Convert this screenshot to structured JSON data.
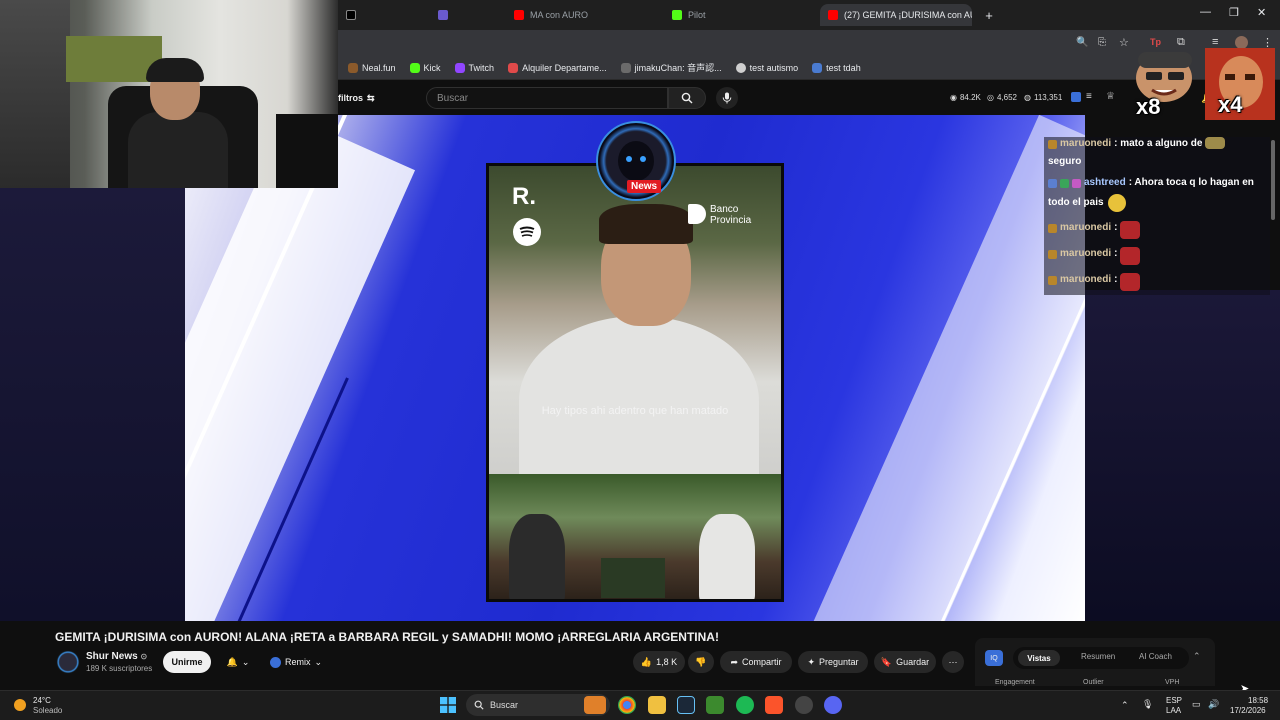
{
  "browser": {
    "tabs": [
      {
        "label": "",
        "icon": "x-icon"
      },
      {
        "label": "",
        "icon": "twitch-icon"
      },
      {
        "label": "MA con AURO",
        "icon": "youtube-icon"
      },
      {
        "label": "Pilot",
        "icon": "kick-icon"
      },
      {
        "label": "",
        "icon": "youtube-icon"
      },
      {
        "label": "(27) GEMITA ¡DURISIMA con AU",
        "icon": "youtube-icon"
      }
    ],
    "bookmarks": [
      {
        "label": "Neal.fun",
        "color": "#8b5a2b"
      },
      {
        "label": "Kick",
        "color": "#53fc18"
      },
      {
        "label": "Twitch",
        "color": "#9146ff"
      },
      {
        "label": "Alquiler Departame...",
        "color": "#e04a4a"
      },
      {
        "label": "jimakuChan: 音声認...",
        "color": "#6b6b6b"
      },
      {
        "label": "test autismo",
        "color": "#cfcfcf"
      },
      {
        "label": "test tdah",
        "color": "#4a7bd0"
      }
    ]
  },
  "yt_header": {
    "filters_label": "filtros",
    "search_placeholder": "Buscar",
    "stats": [
      "84.2K",
      "4,652",
      "113,351"
    ]
  },
  "video": {
    "caption": "Hay tipos ahi adentro que han matado",
    "news_label": "News",
    "r_logo": "R.",
    "bank_line1": "Banco",
    "bank_line2": "Provincia"
  },
  "chat": [
    {
      "user": "maruonedi",
      "message": ": mato a alguno de",
      "cont": "seguro"
    },
    {
      "user": "ashtreed",
      "message": ": Ahora toca q lo hagan en",
      "cont": "todo el pais"
    },
    {
      "user": "maruonedi",
      "message": ":"
    },
    {
      "user": "maruonedi",
      "message": ":"
    },
    {
      "user": "maruonedi",
      "message": ":"
    }
  ],
  "overlay": {
    "mult1": "x8",
    "mult2": "x4"
  },
  "below": {
    "title": "GEMITA ¡DURISIMA con AURON! ALANA ¡RETA a BARBARA REGIL y SAMADHI! MOMO ¡ARREGLARIA ARGENTINA!",
    "channel": "Shur News",
    "subscribers": "189 K suscriptores",
    "join": "Unirme",
    "remix": "Remix",
    "likes": "1,8 K",
    "share": "Compartir",
    "ask": "Preguntar",
    "save": "Guardar"
  },
  "side_panel": {
    "tabs": [
      "Vistas",
      "Resumen",
      "AI Coach"
    ],
    "subtabs": [
      "Engagement",
      "Outlier",
      "VPH"
    ]
  },
  "taskbar": {
    "temp": "24°C",
    "weather": "Soleado",
    "search": "Buscar",
    "lang1": "ESP",
    "lang2": "LAA",
    "time": "18:58",
    "date": "17/2/2026"
  }
}
